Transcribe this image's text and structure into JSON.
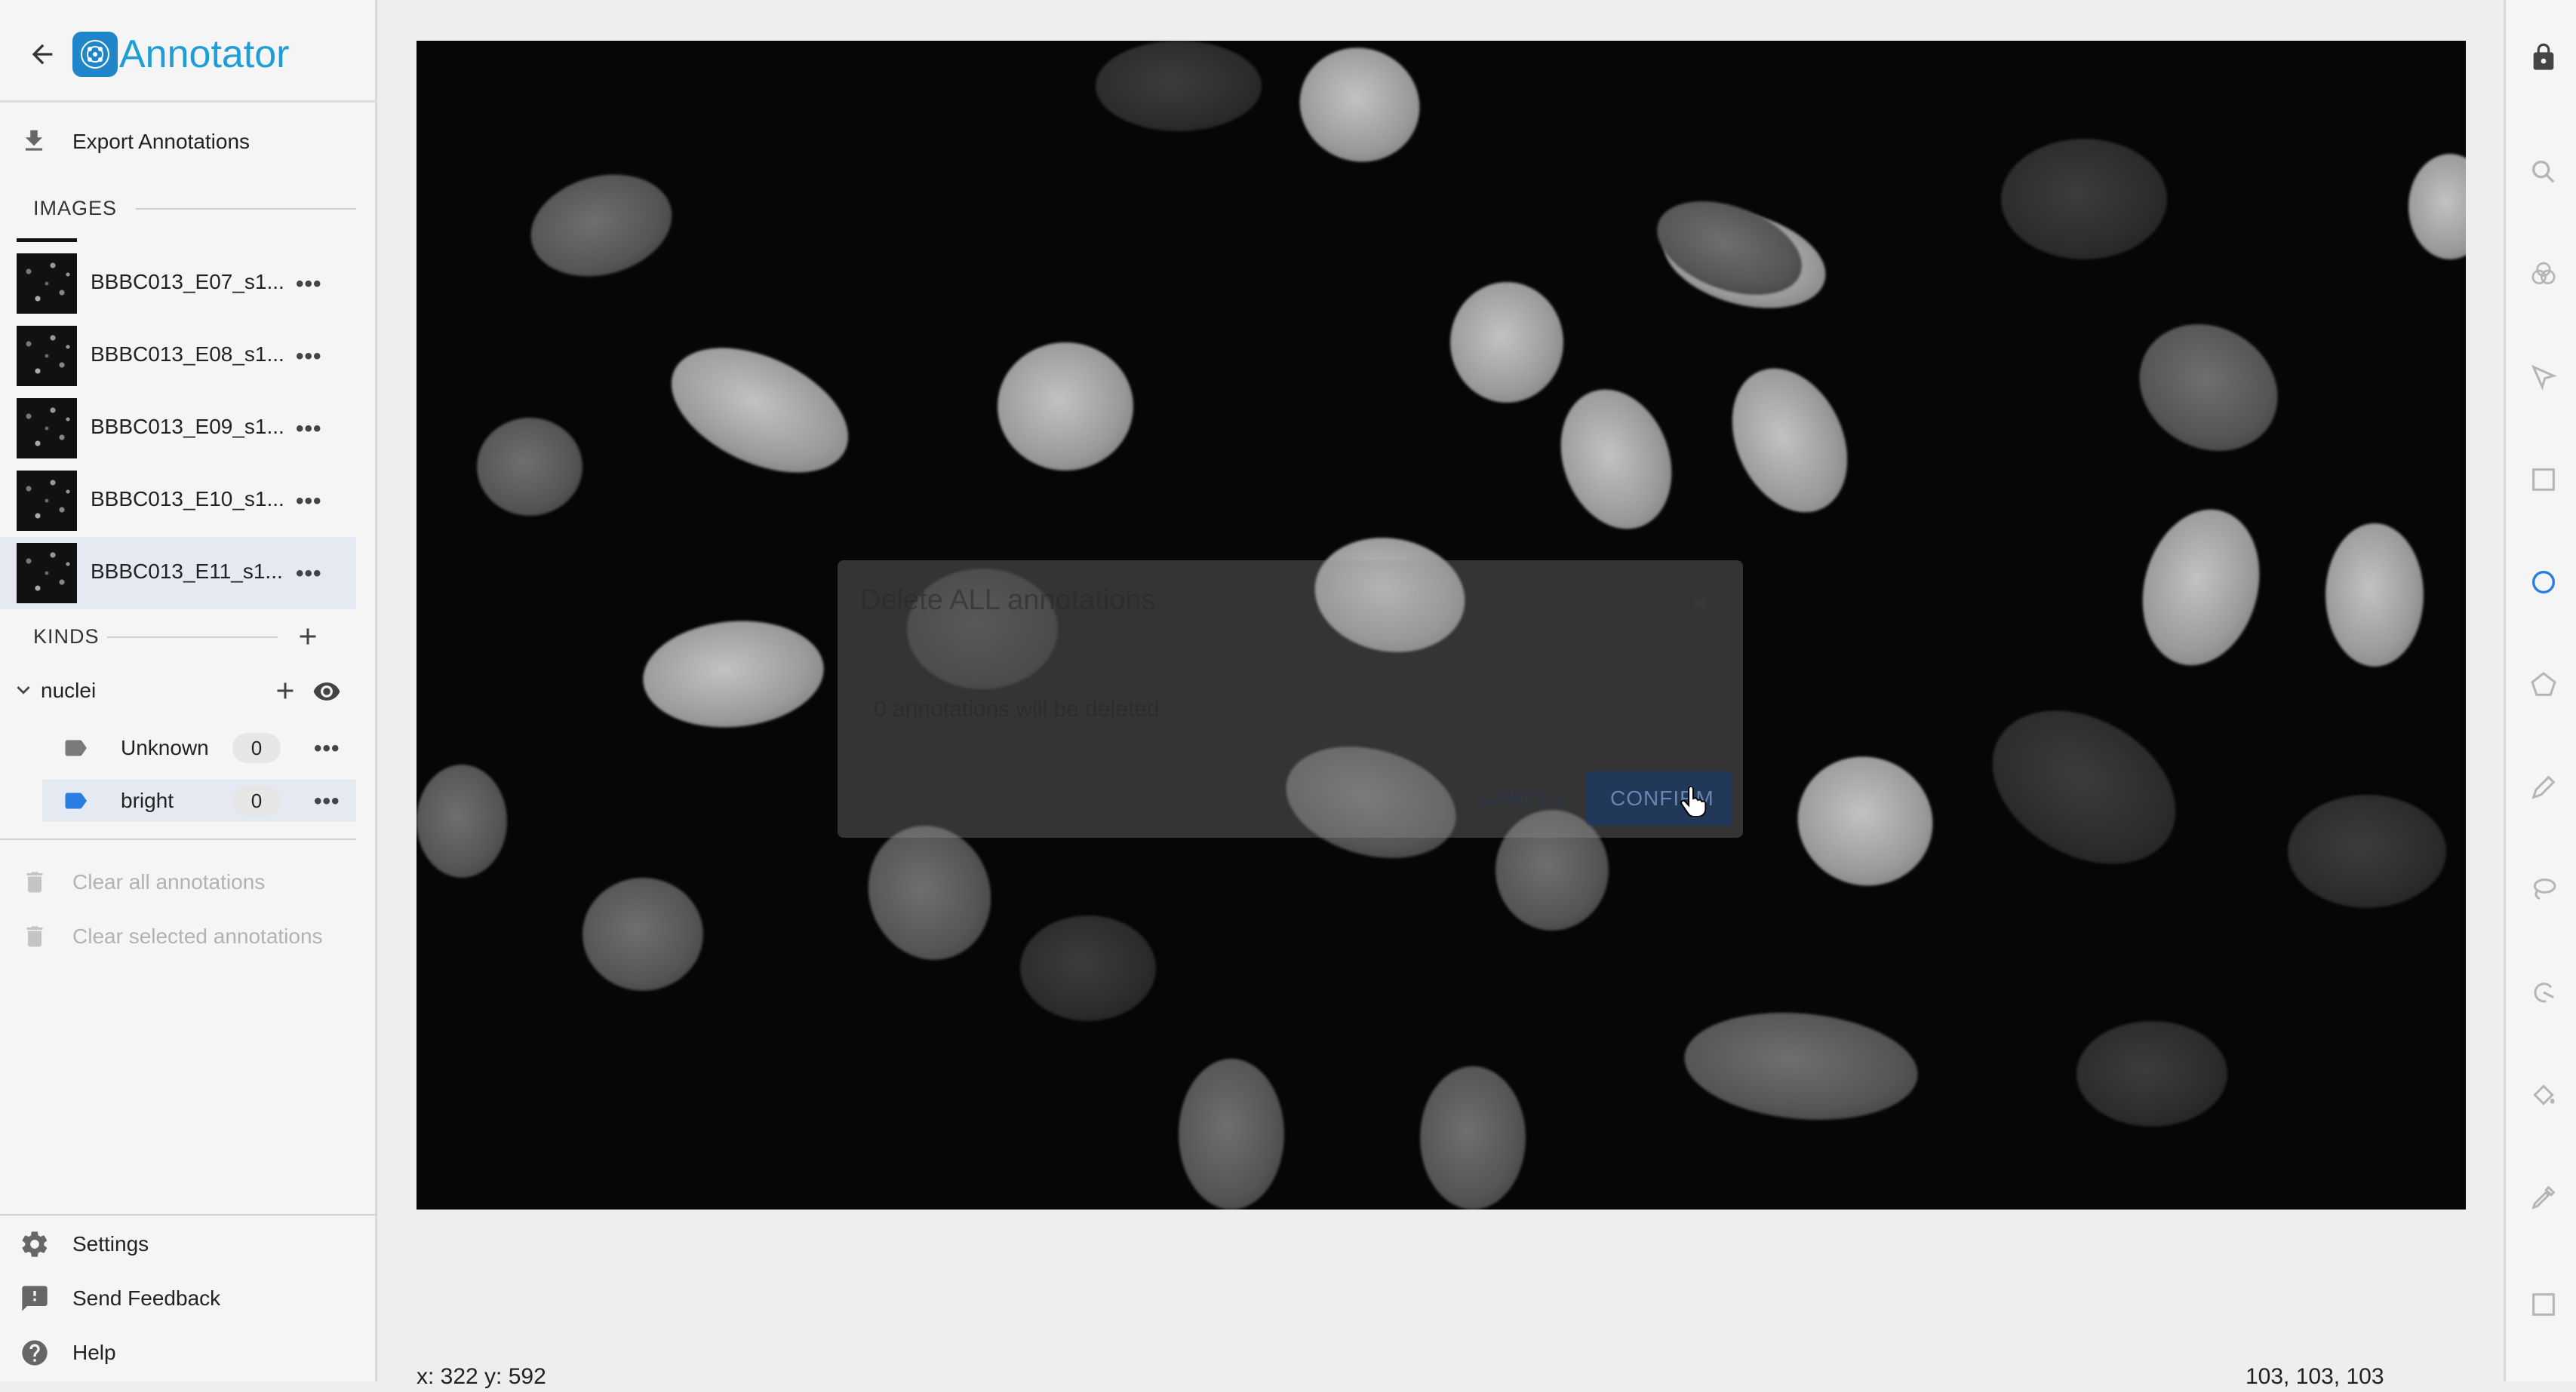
{
  "app": {
    "title": "Annotator"
  },
  "menu": {
    "export": "Export Annotations"
  },
  "images": {
    "header": "IMAGES",
    "items": [
      {
        "label": "BBBC013_E07_s1..."
      },
      {
        "label": "BBBC013_E08_s1..."
      },
      {
        "label": "BBBC013_E09_s1..."
      },
      {
        "label": "BBBC013_E10_s1..."
      },
      {
        "label": "BBBC013_E11_s1..."
      }
    ],
    "selected_index": 4,
    "more_glyph": "•••"
  },
  "kinds": {
    "header": "KINDS",
    "category": "nuclei",
    "items": [
      {
        "label": "Unknown",
        "count": "0",
        "color": "#7a7a7a"
      },
      {
        "label": "bright",
        "count": "0",
        "color": "#2a7de1"
      }
    ]
  },
  "actions": {
    "clear_all": "Clear all annotations",
    "clear_selected": "Clear selected annotations"
  },
  "footer": {
    "settings": "Settings",
    "feedback": "Send Feedback",
    "help": "Help"
  },
  "dialog": {
    "title": "Delete ALL annotations",
    "body": "0 annotations will be deleted",
    "cancel": "CANCEL",
    "confirm": "CONFIRM"
  },
  "status": {
    "coords": "x: 322 y: 592",
    "pixel": "103, 103, 103"
  },
  "colors": {
    "accent": "#1e9ed8",
    "selected_row": "#e4e9f2",
    "active_tool": "#2a7de1"
  },
  "toolbar_icons": [
    "lock-icon",
    "zoom-icon",
    "color-adjust-icon",
    "pointer-select-icon",
    "rectangle-tool-icon",
    "ellipse-tool-icon",
    "polygon-tool-icon",
    "pen-tool-icon",
    "lasso-tool-icon",
    "magnetic-lasso-icon",
    "bucket-fill-icon",
    "color-picker-icon",
    "quick-select-icon"
  ],
  "active_tool": "ellipse-tool-icon"
}
